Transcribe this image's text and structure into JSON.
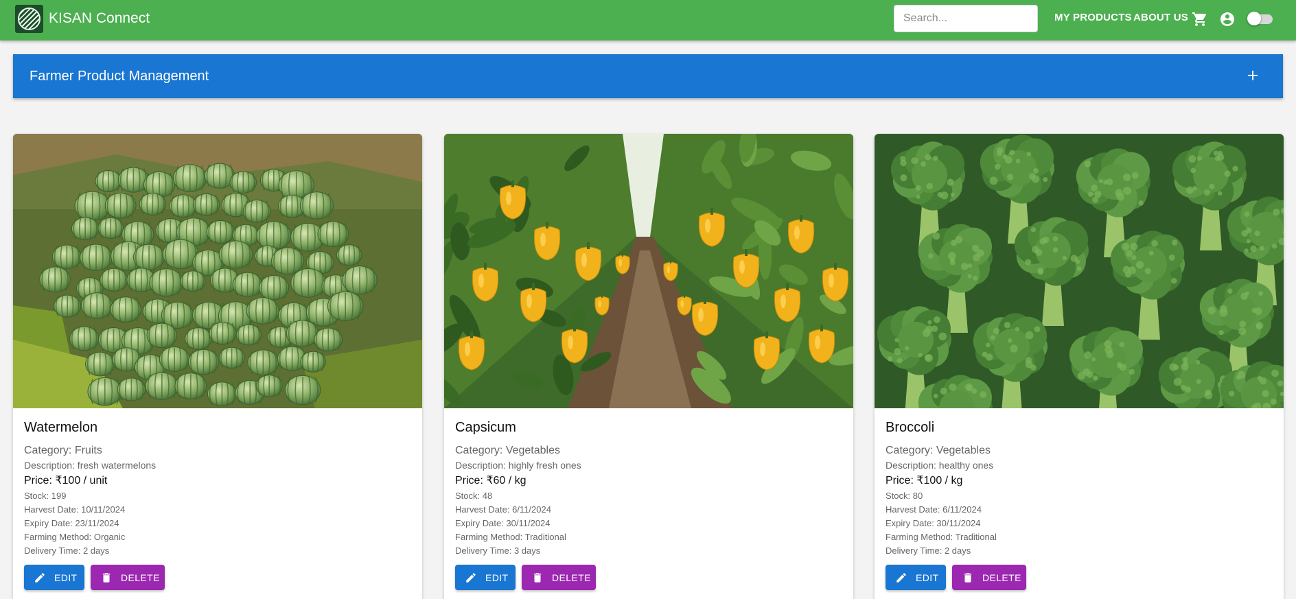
{
  "header": {
    "brand": "KISAN Connect",
    "search_placeholder": "Search...",
    "nav": {
      "my_products": "MY PRODUCTS",
      "about_us": "ABOUT US"
    },
    "icons": [
      "cart-icon",
      "account-circle-icon",
      "theme-toggle"
    ],
    "color": "#4caf50"
  },
  "panel": {
    "title": "Farmer Product Management",
    "color": "#1976d2",
    "icon": "add-icon"
  },
  "products": [
    {
      "name": "Watermelon",
      "category": "Category: Fruits",
      "description": "Description: fresh watermelons",
      "price": "Price: ₹100 / unit",
      "stock": "Stock: 199",
      "harvest_date": "Harvest Date: 10/11/2024",
      "expiry_date": "Expiry Date: 23/11/2024",
      "farming_method": "Farming Method: Organic",
      "delivery_time": "Delivery Time: 2 days",
      "image": "watermelon-photo"
    },
    {
      "name": "Capsicum",
      "category": "Category: Vegetables",
      "description": "Description: highly fresh ones",
      "price": "Price: ₹60 / kg",
      "stock": "Stock: 48",
      "harvest_date": "Harvest Date: 6/11/2024",
      "expiry_date": "Expiry Date: 30/11/2024",
      "farming_method": "Farming Method: Traditional",
      "delivery_time": "Delivery Time: 3 days",
      "image": "capsicum-photo"
    },
    {
      "name": "Broccoli",
      "category": "Category: Vegetables",
      "description": "Description: healthy ones",
      "price": "Price: ₹100 / kg",
      "stock": "Stock: 80",
      "harvest_date": "Harvest Date: 6/11/2024",
      "expiry_date": "Expiry Date: 30/11/2024",
      "farming_method": "Farming Method: Traditional",
      "delivery_time": "Delivery Time: 2 days",
      "image": "broccoli-photo"
    }
  ],
  "buttons": {
    "edit": "EDIT",
    "delete": "DELETE",
    "edit_color": "#1976d2",
    "delete_color": "#9c27b0"
  }
}
